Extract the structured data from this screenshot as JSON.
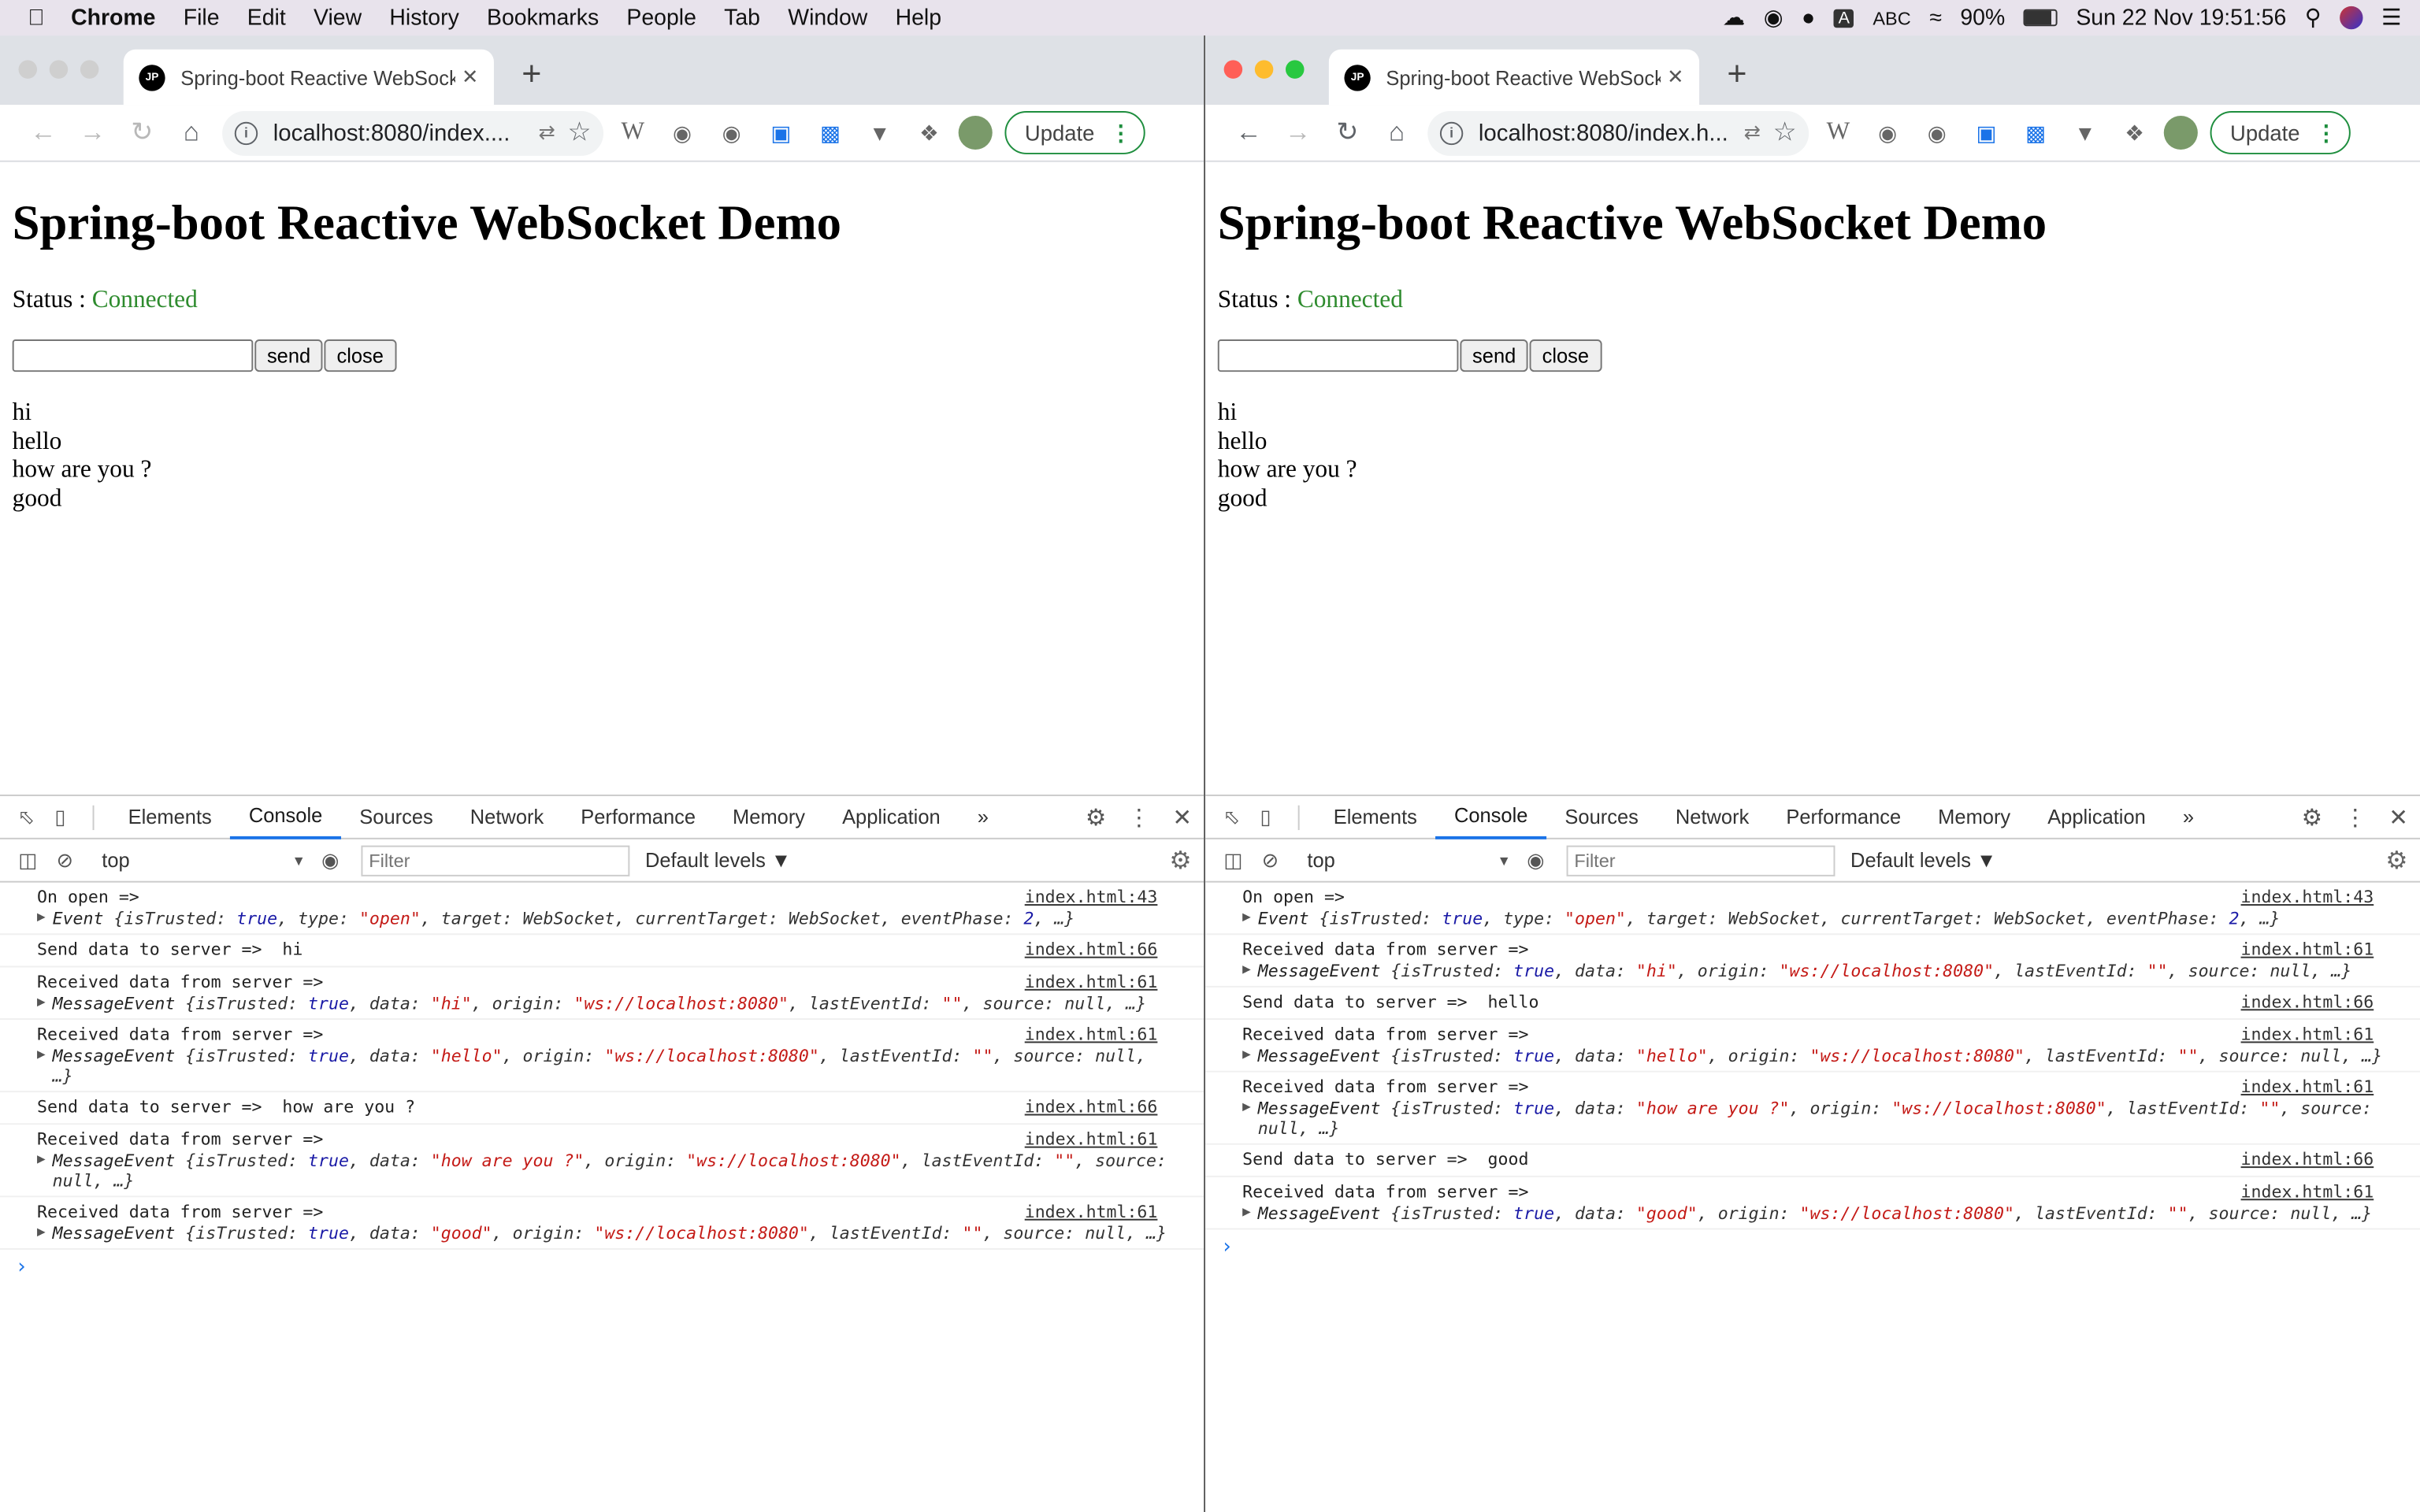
{
  "menubar": {
    "apple": "",
    "app": "Chrome",
    "items": [
      "File",
      "Edit",
      "View",
      "History",
      "Bookmarks",
      "People",
      "Tab",
      "Window",
      "Help"
    ],
    "input_label": "ABC",
    "battery": "90%",
    "datetime": "Sun 22 Nov  19:51:56"
  },
  "windows": [
    {
      "tab_title": "Spring-boot Reactive WebSocket Demo",
      "favicon": "JP",
      "url": "localhost:8080/index....",
      "update_label": "Update",
      "page": {
        "heading": "Spring-boot Reactive WebSocket Demo",
        "status_label": "Status : ",
        "status_value": "Connected",
        "send_label": "send",
        "close_label": "close",
        "messages": [
          "hi",
          "hello",
          "how are you ?",
          "good"
        ]
      },
      "devtools": {
        "tabs": [
          "Elements",
          "Console",
          "Sources",
          "Network",
          "Performance",
          "Memory",
          "Application"
        ],
        "more": "»",
        "context": "top",
        "filter_placeholder": "Filter",
        "levels": "Default levels ▼",
        "log": [
          {
            "text": "On open =>",
            "src": "index.html:43",
            "obj": {
              "type": "Event",
              "parts": [
                [
                  "k",
                  "isTrusted: "
                ],
                [
                  "b",
                  "true"
                ],
                [
                  "k",
                  ", type: "
                ],
                [
                  "s",
                  "\"open\""
                ],
                [
                  "k",
                  ", target: "
                ],
                [
                  "k",
                  "WebSocket"
                ],
                [
                  "k",
                  ", currentTarget: "
                ],
                [
                  "k",
                  "WebSocket"
                ],
                [
                  "k",
                  ", eventPhase: "
                ],
                [
                  "b",
                  "2"
                ],
                [
                  "k",
                  ", …}"
                ]
              ]
            }
          },
          {
            "text": "Send data to server =>  hi",
            "src": "index.html:66"
          },
          {
            "text": "Received data from server =>",
            "src": "index.html:61",
            "obj": {
              "type": "MessageEvent",
              "parts": [
                [
                  "k",
                  "isTrusted: "
                ],
                [
                  "b",
                  "true"
                ],
                [
                  "k",
                  ", data: "
                ],
                [
                  "s",
                  "\"hi\""
                ],
                [
                  "k",
                  ", origin: "
                ],
                [
                  "s",
                  "\"ws://localhost:8080\""
                ],
                [
                  "k",
                  ", lastEventId: "
                ],
                [
                  "s",
                  "\"\""
                ],
                [
                  "k",
                  ", source: null, …}"
                ]
              ]
            }
          },
          {
            "text": "Received data from server =>",
            "src": "index.html:61",
            "obj": {
              "type": "MessageEvent",
              "parts": [
                [
                  "k",
                  "isTrusted: "
                ],
                [
                  "b",
                  "true"
                ],
                [
                  "k",
                  ", data: "
                ],
                [
                  "s",
                  "\"hello\""
                ],
                [
                  "k",
                  ", origin: "
                ],
                [
                  "s",
                  "\"ws://localhost:8080\""
                ],
                [
                  "k",
                  ", lastEventId: "
                ],
                [
                  "s",
                  "\"\""
                ],
                [
                  "k",
                  ", source: null, …}"
                ]
              ]
            }
          },
          {
            "text": "Send data to server =>  how are you ?",
            "src": "index.html:66"
          },
          {
            "text": "Received data from server =>",
            "src": "index.html:61",
            "obj": {
              "type": "MessageEvent",
              "parts": [
                [
                  "k",
                  "isTrusted: "
                ],
                [
                  "b",
                  "true"
                ],
                [
                  "k",
                  ", data: "
                ],
                [
                  "s",
                  "\"how are you ?\""
                ],
                [
                  "k",
                  ", origin: "
                ],
                [
                  "s",
                  "\"ws://localhost:8080\""
                ],
                [
                  "k",
                  ", lastEventId: "
                ],
                [
                  "s",
                  "\"\""
                ],
                [
                  "k",
                  ", source: null, …}"
                ]
              ]
            }
          },
          {
            "text": "Received data from server =>",
            "src": "index.html:61",
            "obj": {
              "type": "MessageEvent",
              "parts": [
                [
                  "k",
                  "isTrusted: "
                ],
                [
                  "b",
                  "true"
                ],
                [
                  "k",
                  ", data: "
                ],
                [
                  "s",
                  "\"good\""
                ],
                [
                  "k",
                  ", origin: "
                ],
                [
                  "s",
                  "\"ws://localhost:8080\""
                ],
                [
                  "k",
                  ", lastEventId: "
                ],
                [
                  "s",
                  "\"\""
                ],
                [
                  "k",
                  ", source: null, …}"
                ]
              ]
            }
          }
        ]
      }
    },
    {
      "tab_title": "Spring-boot Reactive WebSocket Demo",
      "favicon": "JP",
      "url": "localhost:8080/index.h...",
      "update_label": "Update",
      "page": {
        "heading": "Spring-boot Reactive WebSocket Demo",
        "status_label": "Status : ",
        "status_value": "Connected",
        "send_label": "send",
        "close_label": "close",
        "messages": [
          "hi",
          "hello",
          "how are you ?",
          "good"
        ]
      },
      "devtools": {
        "tabs": [
          "Elements",
          "Console",
          "Sources",
          "Network",
          "Performance",
          "Memory",
          "Application"
        ],
        "more": "»",
        "context": "top",
        "filter_placeholder": "Filter",
        "levels": "Default levels ▼",
        "log": [
          {
            "text": "On open =>",
            "src": "index.html:43",
            "obj": {
              "type": "Event",
              "parts": [
                [
                  "k",
                  "isTrusted: "
                ],
                [
                  "b",
                  "true"
                ],
                [
                  "k",
                  ", type: "
                ],
                [
                  "s",
                  "\"open\""
                ],
                [
                  "k",
                  ", target: "
                ],
                [
                  "k",
                  "WebSocket"
                ],
                [
                  "k",
                  ", currentTarget: "
                ],
                [
                  "k",
                  "WebSocket"
                ],
                [
                  "k",
                  ", eventPhase: "
                ],
                [
                  "b",
                  "2"
                ],
                [
                  "k",
                  ", …}"
                ]
              ]
            }
          },
          {
            "text": "Received data from server =>",
            "src": "index.html:61",
            "obj": {
              "type": "MessageEvent",
              "parts": [
                [
                  "k",
                  "isTrusted: "
                ],
                [
                  "b",
                  "true"
                ],
                [
                  "k",
                  ", data: "
                ],
                [
                  "s",
                  "\"hi\""
                ],
                [
                  "k",
                  ", origin: "
                ],
                [
                  "s",
                  "\"ws://localhost:8080\""
                ],
                [
                  "k",
                  ", lastEventId: "
                ],
                [
                  "s",
                  "\"\""
                ],
                [
                  "k",
                  ", source: null, …}"
                ]
              ]
            }
          },
          {
            "text": "Send data to server =>  hello",
            "src": "index.html:66"
          },
          {
            "text": "Received data from server =>",
            "src": "index.html:61",
            "obj": {
              "type": "MessageEvent",
              "parts": [
                [
                  "k",
                  "isTrusted: "
                ],
                [
                  "b",
                  "true"
                ],
                [
                  "k",
                  ", data: "
                ],
                [
                  "s",
                  "\"hello\""
                ],
                [
                  "k",
                  ", origin: "
                ],
                [
                  "s",
                  "\"ws://localhost:8080\""
                ],
                [
                  "k",
                  ", lastEventId: "
                ],
                [
                  "s",
                  "\"\""
                ],
                [
                  "k",
                  ", source: null, …}"
                ]
              ]
            }
          },
          {
            "text": "Received data from server =>",
            "src": "index.html:61",
            "obj": {
              "type": "MessageEvent",
              "parts": [
                [
                  "k",
                  "isTrusted: "
                ],
                [
                  "b",
                  "true"
                ],
                [
                  "k",
                  ", data: "
                ],
                [
                  "s",
                  "\"how are you ?\""
                ],
                [
                  "k",
                  ", origin: "
                ],
                [
                  "s",
                  "\"ws://localhost:8080\""
                ],
                [
                  "k",
                  ", lastEventId: "
                ],
                [
                  "s",
                  "\"\""
                ],
                [
                  "k",
                  ", source: null, …}"
                ]
              ]
            }
          },
          {
            "text": "Send data to server =>  good",
            "src": "index.html:66"
          },
          {
            "text": "Received data from server =>",
            "src": "index.html:61",
            "obj": {
              "type": "MessageEvent",
              "parts": [
                [
                  "k",
                  "isTrusted: "
                ],
                [
                  "b",
                  "true"
                ],
                [
                  "k",
                  ", data: "
                ],
                [
                  "s",
                  "\"good\""
                ],
                [
                  "k",
                  ", origin: "
                ],
                [
                  "s",
                  "\"ws://localhost:8080\""
                ],
                [
                  "k",
                  ", lastEventId: "
                ],
                [
                  "s",
                  "\"\""
                ],
                [
                  "k",
                  ", source: null, …}"
                ]
              ]
            }
          }
        ]
      }
    }
  ]
}
